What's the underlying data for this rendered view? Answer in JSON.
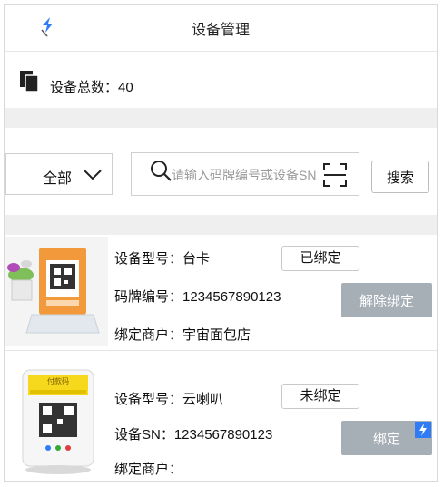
{
  "header": {
    "title": "设备管理"
  },
  "summary": {
    "text": "设备总数：40"
  },
  "filter": {
    "dropdown_value": "全部",
    "search_placeholder": "请输入码牌编号或设备SN",
    "search_button": "搜索"
  },
  "devices": [
    {
      "type_line": "设备型号：台卡",
      "id_line": "码牌编号：1234567890123",
      "merchant_line": "绑定商户：宇宙面包店",
      "status": "已绑定",
      "action": "解除绑定"
    },
    {
      "type_line": "设备型号：云喇叭",
      "id_line": "设备SN：1234567890123",
      "merchant_line": "绑定商户：",
      "status": "未绑定",
      "action": "绑定",
      "sticker_text": "付款码"
    }
  ],
  "colors": {
    "button_gray": "#a6aeb6",
    "accent_blue": "#2f7cf6",
    "divider": "#efefef",
    "orange_stand": "#f29a3b"
  }
}
